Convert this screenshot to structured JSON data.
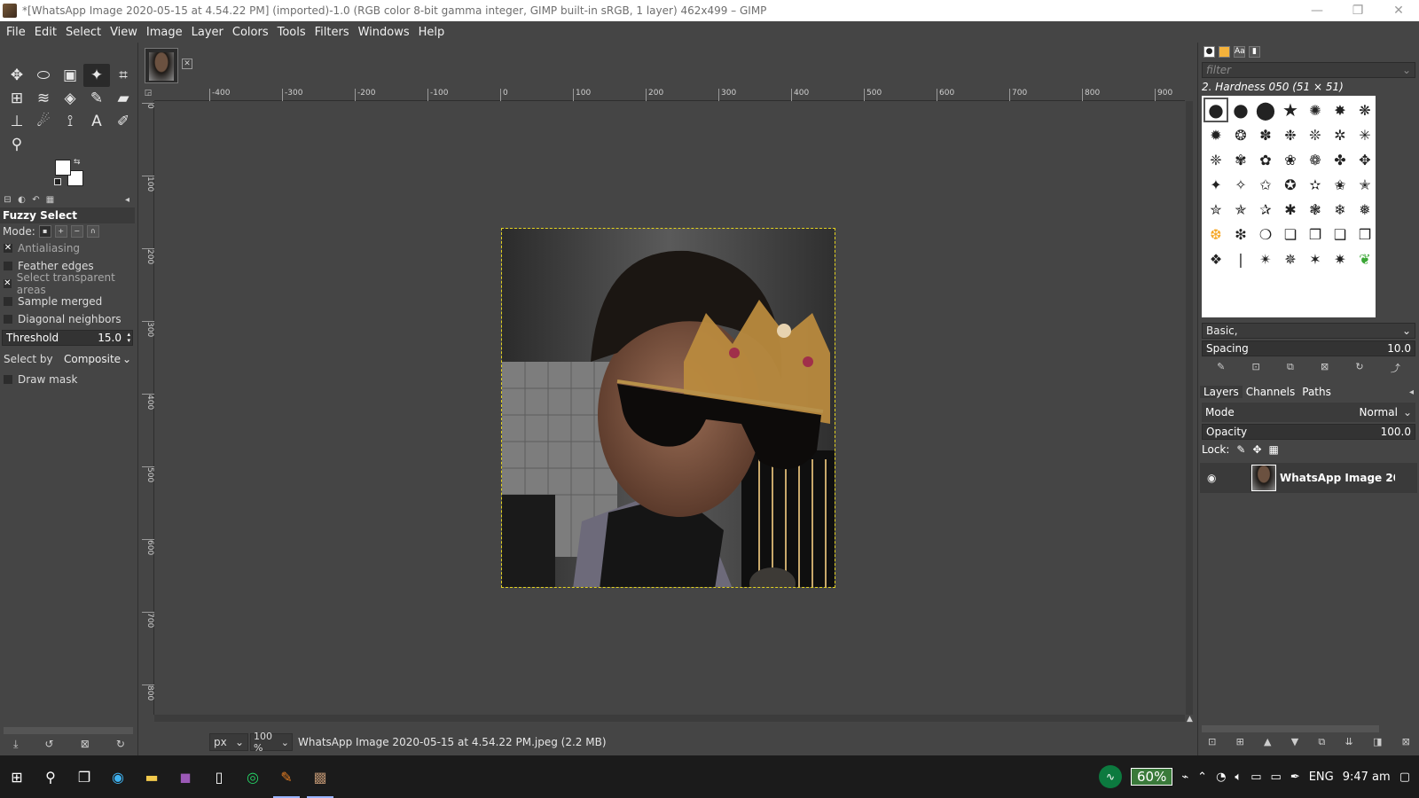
{
  "window": {
    "title": "*[WhatsApp Image 2020-05-15 at 4.54.22 PM] (imported)-1.0 (RGB color 8-bit gamma integer, GIMP built-in sRGB, 1 layer) 462x499 – GIMP",
    "minimize": "—",
    "restore": "❐",
    "close": "✕"
  },
  "menu": [
    "File",
    "Edit",
    "Select",
    "View",
    "Image",
    "Layer",
    "Colors",
    "Tools",
    "Filters",
    "Windows",
    "Help"
  ],
  "tools": [
    {
      "name": "move-tool-icon",
      "glyph": "✥"
    },
    {
      "name": "ellipse-select-icon",
      "glyph": "⬭"
    },
    {
      "name": "foreground-select-icon",
      "glyph": "▣"
    },
    {
      "name": "fuzzy-select-icon",
      "glyph": "✦",
      "active": true
    },
    {
      "name": "crop-tool-icon",
      "glyph": "⌗"
    },
    {
      "name": "unified-transform-icon",
      "glyph": "⊞"
    },
    {
      "name": "warp-transform-icon",
      "glyph": "≋"
    },
    {
      "name": "bucket-fill-icon",
      "glyph": "◈"
    },
    {
      "name": "paintbrush-icon",
      "glyph": "✎"
    },
    {
      "name": "eraser-icon",
      "glyph": "▰"
    },
    {
      "name": "clone-tool-icon",
      "glyph": "⊥"
    },
    {
      "name": "smudge-tool-icon",
      "glyph": "☄"
    },
    {
      "name": "paths-tool-icon",
      "glyph": "⟟"
    },
    {
      "name": "text-tool-icon",
      "glyph": "A"
    },
    {
      "name": "color-picker-icon",
      "glyph": "✐"
    },
    {
      "name": "zoom-tool-icon",
      "glyph": "⚲"
    }
  ],
  "tool_options": {
    "title": "Fuzzy Select",
    "mode_label": "Mode:",
    "antialiasing": "Antialiasing",
    "feather_edges": "Feather edges",
    "select_transparent": "Select transparent areas",
    "sample_merged": "Sample merged",
    "diagonal_neighbors": "Diagonal neighbors",
    "threshold_label": "Threshold",
    "threshold_value": "15.0",
    "select_by_label": "Select by",
    "select_by_value": "Composite",
    "draw_mask": "Draw mask"
  },
  "rulers": {
    "h": [
      "-400",
      "-300",
      "-200",
      "-100",
      "0",
      "100",
      "200",
      "300",
      "400",
      "500",
      "600",
      "700",
      "800",
      "900"
    ],
    "v": [
      "0",
      "100",
      "200",
      "300",
      "400",
      "500",
      "600",
      "700",
      "800"
    ]
  },
  "status": {
    "unit": "px",
    "zoom": "100 %",
    "text": "WhatsApp Image 2020-05-15 at 4.54.22 PM.jpeg (2.2 MB)"
  },
  "brushes": {
    "filter_placeholder": "filter",
    "current": "2. Hardness 050 (51 × 51)",
    "preset": "Basic,",
    "spacing_label": "Spacing",
    "spacing_value": "10.0"
  },
  "layers": {
    "tabs": [
      "Layers",
      "Channels",
      "Paths"
    ],
    "mode_label": "Mode",
    "mode_value": "Normal",
    "opacity_label": "Opacity",
    "opacity_value": "100.0",
    "lock_label": "Lock:",
    "layer_name": "WhatsApp Image 20"
  },
  "taskbar": {
    "battery": "60%",
    "lang": "ENG",
    "time": "9:47 am"
  }
}
